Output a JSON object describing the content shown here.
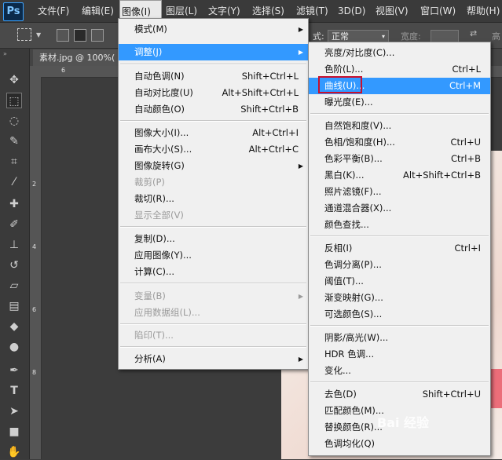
{
  "menubar": {
    "logo": "Ps",
    "items": [
      "文件(F)",
      "编辑(E)",
      "图像(I)",
      "图层(L)",
      "文字(Y)",
      "选择(S)",
      "滤镜(T)",
      "3D(D)",
      "视图(V)",
      "窗口(W)",
      "帮助(H)"
    ]
  },
  "options": {
    "style_label": "式:",
    "style_value": "正常",
    "width_label": "宽度:",
    "height_label": "高"
  },
  "document": {
    "tab_label": "素材.jpg @ 100%(",
    "ruler_top": [
      "6",
      "4",
      "2",
      "0",
      "2",
      "4"
    ],
    "ruler_left": [
      "2",
      "4",
      "6",
      "8"
    ]
  },
  "image_menu": {
    "items": [
      {
        "label": "模式(M)",
        "shortcut": "",
        "submenu": true,
        "disabled": false
      },
      {
        "label": "调整(J)",
        "shortcut": "",
        "submenu": true,
        "disabled": false,
        "highlight": true
      },
      {
        "label": "自动色调(N)",
        "shortcut": "Shift+Ctrl+L",
        "disabled": false
      },
      {
        "label": "自动对比度(U)",
        "shortcut": "Alt+Shift+Ctrl+L",
        "disabled": false
      },
      {
        "label": "自动颜色(O)",
        "shortcut": "Shift+Ctrl+B",
        "disabled": false
      },
      {
        "label": "图像大小(I)...",
        "shortcut": "Alt+Ctrl+I",
        "disabled": false
      },
      {
        "label": "画布大小(S)...",
        "shortcut": "Alt+Ctrl+C",
        "disabled": false
      },
      {
        "label": "图像旋转(G)",
        "shortcut": "",
        "submenu": true,
        "disabled": false
      },
      {
        "label": "裁剪(P)",
        "shortcut": "",
        "disabled": true
      },
      {
        "label": "裁切(R)...",
        "shortcut": "",
        "disabled": false
      },
      {
        "label": "显示全部(V)",
        "shortcut": "",
        "disabled": true
      },
      {
        "label": "复制(D)...",
        "shortcut": "",
        "disabled": false
      },
      {
        "label": "应用图像(Y)...",
        "shortcut": "",
        "disabled": false
      },
      {
        "label": "计算(C)...",
        "shortcut": "",
        "disabled": false
      },
      {
        "label": "变量(B)",
        "shortcut": "",
        "submenu": true,
        "disabled": true
      },
      {
        "label": "应用数据组(L)...",
        "shortcut": "",
        "disabled": true
      },
      {
        "label": "陷印(T)...",
        "shortcut": "",
        "disabled": true
      },
      {
        "label": "分析(A)",
        "shortcut": "",
        "submenu": true,
        "disabled": false
      }
    ]
  },
  "adjust_menu": {
    "items": [
      {
        "label": "亮度/对比度(C)...",
        "shortcut": ""
      },
      {
        "label": "色阶(L)...",
        "shortcut": "Ctrl+L"
      },
      {
        "label": "曲线(U)...",
        "shortcut": "Ctrl+M",
        "highlight": true
      },
      {
        "label": "曝光度(E)...",
        "shortcut": ""
      },
      {
        "label": "自然饱和度(V)...",
        "shortcut": ""
      },
      {
        "label": "色相/饱和度(H)...",
        "shortcut": "Ctrl+U"
      },
      {
        "label": "色彩平衡(B)...",
        "shortcut": "Ctrl+B"
      },
      {
        "label": "黑白(K)...",
        "shortcut": "Alt+Shift+Ctrl+B"
      },
      {
        "label": "照片滤镜(F)...",
        "shortcut": ""
      },
      {
        "label": "通道混合器(X)...",
        "shortcut": ""
      },
      {
        "label": "颜色查找...",
        "shortcut": ""
      },
      {
        "label": "反相(I)",
        "shortcut": "Ctrl+I"
      },
      {
        "label": "色调分离(P)...",
        "shortcut": ""
      },
      {
        "label": "阈值(T)...",
        "shortcut": ""
      },
      {
        "label": "渐变映射(G)...",
        "shortcut": ""
      },
      {
        "label": "可选颜色(S)...",
        "shortcut": ""
      },
      {
        "label": "阴影/高光(W)...",
        "shortcut": ""
      },
      {
        "label": "HDR 色调...",
        "shortcut": ""
      },
      {
        "label": "变化...",
        "shortcut": ""
      },
      {
        "label": "去色(D)",
        "shortcut": "Shift+Ctrl+U"
      },
      {
        "label": "匹配颜色(M)...",
        "shortcut": ""
      },
      {
        "label": "替换颜色(R)...",
        "shortcut": ""
      },
      {
        "label": "色调均化(Q)",
        "shortcut": ""
      }
    ]
  },
  "watermark": "Bai 经验",
  "colors": {
    "highlight": "#3399ff",
    "annotation_box": "#c8102e"
  }
}
